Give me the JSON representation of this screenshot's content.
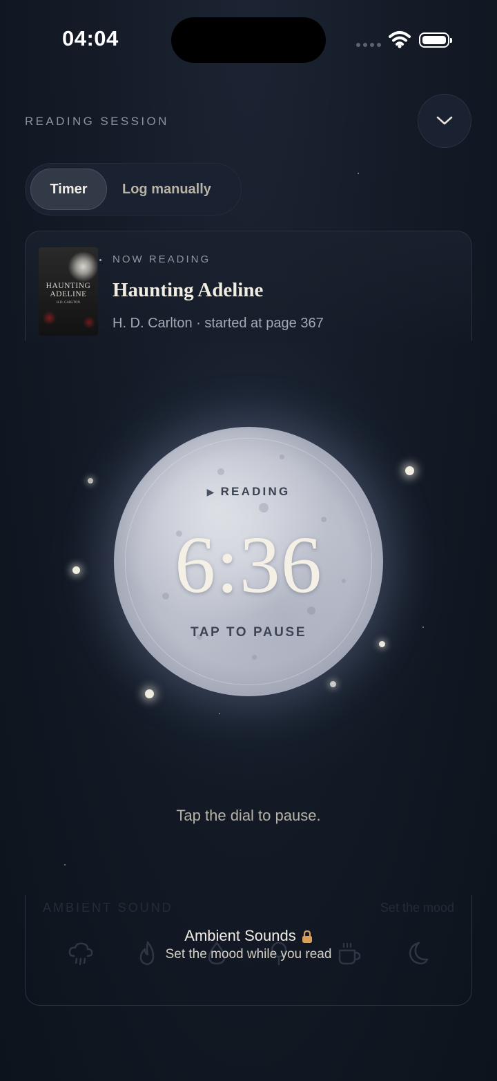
{
  "status_bar": {
    "time": "04:04"
  },
  "header": {
    "title": "READING SESSION"
  },
  "mode_toggle": {
    "timer_label": "Timer",
    "log_label": "Log manually",
    "selected": "Timer"
  },
  "now_reading": {
    "label": "NOW READING",
    "book_title": "Haunting Adeline",
    "subtitle": "H. D. Carlton · started at page 367",
    "cover_title": "HAUNTING ADELINE",
    "cover_author": "H.D. CARLTON"
  },
  "dial": {
    "status": "READING",
    "elapsed": "6:36",
    "action": "TAP TO PAUSE"
  },
  "hint": "Tap the dial to pause.",
  "ambient": {
    "label": "AMBIENT SOUND",
    "side_label": "Set the mood",
    "locked_title": "Ambient Sounds",
    "locked_subtitle": "Set the mood while you read",
    "icons": [
      "rain-icon",
      "fire-icon",
      "water-icon",
      "forest-icon",
      "coffee-icon",
      "moon-icon"
    ]
  },
  "colors": {
    "background": "#141b27",
    "accent_lock": "#d9a05b",
    "dial": "#c2c6d2"
  }
}
